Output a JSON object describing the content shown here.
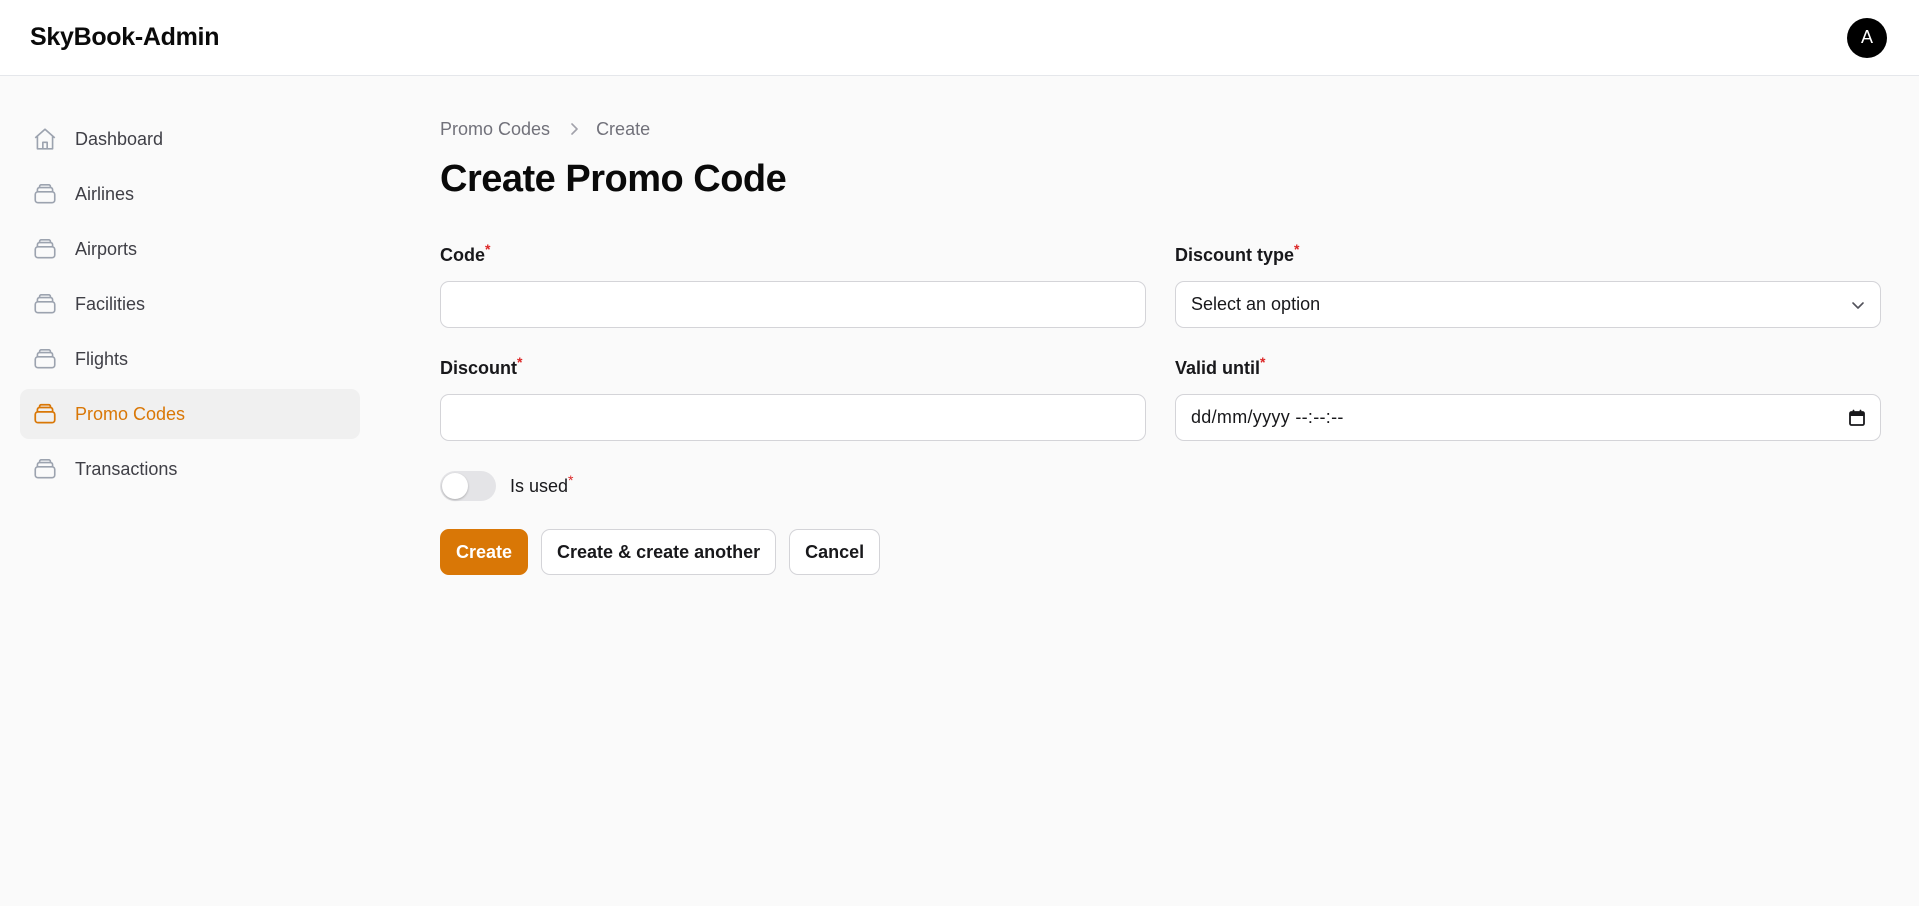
{
  "header": {
    "brand": "SkyBook-Admin",
    "avatar_initial": "A"
  },
  "sidebar": {
    "items": [
      {
        "label": "Dashboard",
        "icon": "home-icon",
        "active": false
      },
      {
        "label": "Airlines",
        "icon": "stack-icon",
        "active": false
      },
      {
        "label": "Airports",
        "icon": "stack-icon",
        "active": false
      },
      {
        "label": "Facilities",
        "icon": "stack-icon",
        "active": false
      },
      {
        "label": "Flights",
        "icon": "stack-icon",
        "active": false
      },
      {
        "label": "Promo Codes",
        "icon": "stack-icon",
        "active": true
      },
      {
        "label": "Transactions",
        "icon": "stack-icon",
        "active": false
      }
    ],
    "accent_color": "#d97706"
  },
  "breadcrumb": {
    "items": [
      "Promo Codes",
      "Create"
    ]
  },
  "page": {
    "title": "Create Promo Code"
  },
  "form": {
    "code": {
      "label": "Code",
      "value": "",
      "required_mark": "*"
    },
    "discount_type": {
      "label": "Discount type",
      "value": "Select an option",
      "required_mark": "*"
    },
    "discount": {
      "label": "Discount",
      "value": "",
      "required_mark": "*"
    },
    "valid_until": {
      "label": "Valid until",
      "placeholder": "dd/mm/yyyy --:--:--",
      "required_mark": "*"
    },
    "is_used": {
      "label": "Is used",
      "checked": false,
      "required_mark": "*"
    }
  },
  "actions": {
    "create": "Create",
    "create_another": "Create & create another",
    "cancel": "Cancel"
  }
}
